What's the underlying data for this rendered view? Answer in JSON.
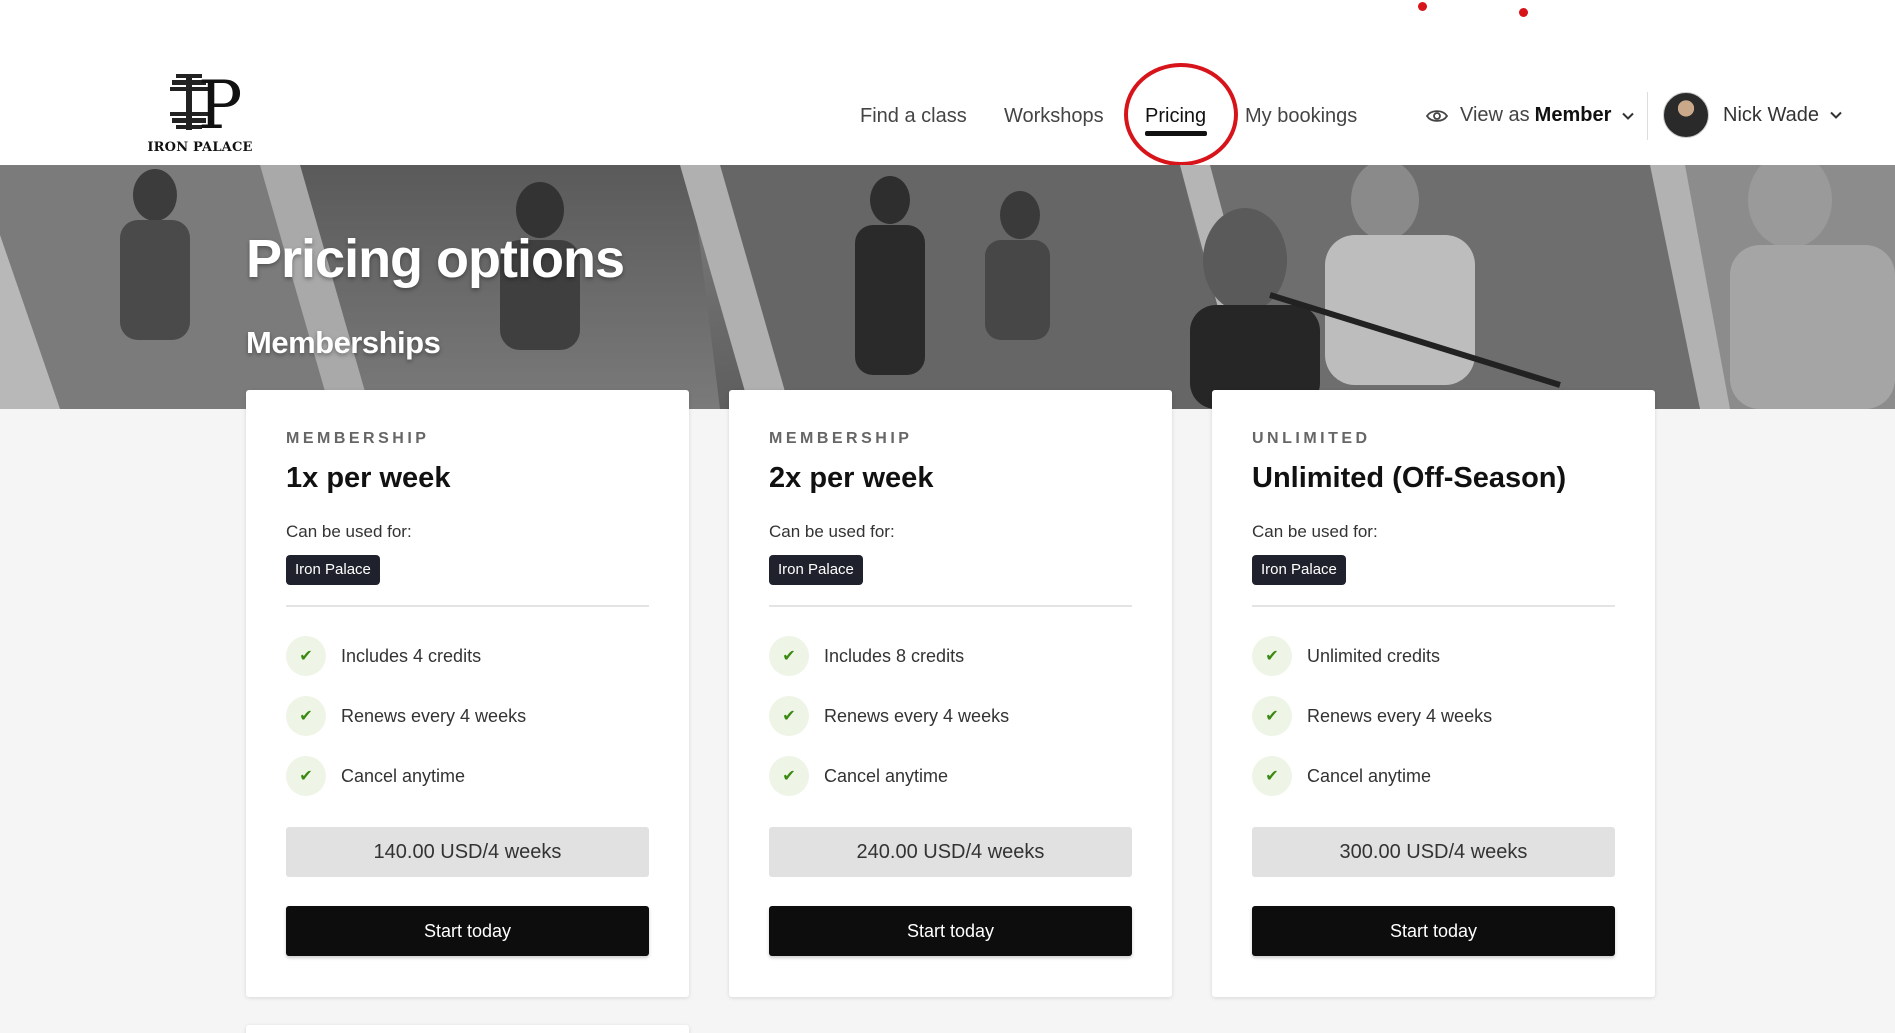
{
  "brand": {
    "logo_text": "IRON PALACE"
  },
  "nav": {
    "items": [
      {
        "label": "Find a class"
      },
      {
        "label": "Workshops"
      },
      {
        "label": "Pricing"
      },
      {
        "label": "My bookings"
      }
    ],
    "active": "Pricing"
  },
  "view_as": {
    "prefix": "View as",
    "role": "Member"
  },
  "user": {
    "name": "Nick Wade"
  },
  "hero": {
    "title": "Pricing options",
    "subtitle": "Memberships"
  },
  "plans": [
    {
      "eyebrow": "MEMBERSHIP",
      "title": "1x per week",
      "used_for_label": "Can be used for:",
      "tag": "Iron Palace",
      "features": [
        "Includes 4 credits",
        "Renews every 4 weeks",
        "Cancel anytime"
      ],
      "price": "140.00 USD/4 weeks",
      "cta": "Start today"
    },
    {
      "eyebrow": "MEMBERSHIP",
      "title": "2x per week",
      "used_for_label": "Can be used for:",
      "tag": "Iron Palace",
      "features": [
        "Includes 8 credits",
        "Renews every 4 weeks",
        "Cancel anytime"
      ],
      "price": "240.00 USD/4 weeks",
      "cta": "Start today"
    },
    {
      "eyebrow": "UNLIMITED",
      "title": "Unlimited (Off-Season)",
      "used_for_label": "Can be used for:",
      "tag": "Iron Palace",
      "features": [
        "Unlimited credits",
        "Renews every 4 weeks",
        "Cancel anytime"
      ],
      "price": "300.00 USD/4 weeks",
      "cta": "Start today"
    }
  ],
  "colors": {
    "accent_dark": "#0d0d0d",
    "tag_bg": "#1f222c",
    "check_green": "#3a8a12",
    "annotation_red": "#d7141a"
  },
  "icons": {
    "view_as": "eye-icon",
    "feature": "check-icon",
    "dropdown": "chevron-down-icon"
  }
}
